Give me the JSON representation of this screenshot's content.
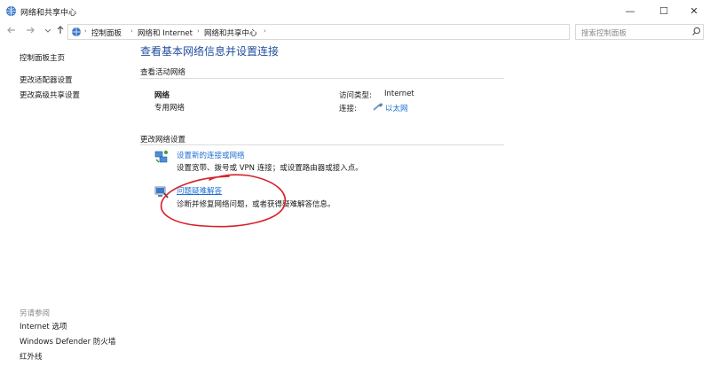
{
  "window": {
    "title": "网络和共享中心",
    "minimize_glyph": "—",
    "maximize_glyph": "☐",
    "close_glyph": "✕"
  },
  "address_bar": {
    "breadcrumbs": [
      "控制面板",
      "网络和 Internet",
      "网络和共享中心"
    ],
    "search_placeholder": "搜索控制面板"
  },
  "sidebar": {
    "links": [
      "控制面板主页",
      "更改适配器设置",
      "更改高级共享设置"
    ],
    "see_also_heading": "另请参阅",
    "see_also": [
      "Internet 选项",
      "Windows Defender 防火墙",
      "红外线"
    ]
  },
  "main": {
    "title": "查看基本网络信息并设置连接",
    "active_networks_label": "查看活动网络",
    "network": {
      "name": "网络",
      "type": "专用网络",
      "access_type_label": "访问类型:",
      "access_type_value": "Internet",
      "connections_label": "连接:",
      "connection_value": "以太网"
    },
    "change_settings_label": "更改网络设置",
    "tasks": [
      {
        "link": "设置新的连接或网络",
        "description": "设置宽带、拨号或 VPN 连接；或设置路由器或接入点。"
      },
      {
        "link": "问题疑难解答",
        "description": "诊断并修复网络问题，或者获得疑难解答信息。"
      }
    ]
  },
  "colors": {
    "title_blue": "#1f4e9c",
    "link_blue": "#1f6fd1",
    "annotation_red": "#d8202a"
  },
  "icons": {
    "window": "network-globe-icon",
    "back": "arrow-left-icon",
    "forward": "arrow-right-icon",
    "up": "arrow-up-icon",
    "refresh": "refresh-icon",
    "search": "search-icon",
    "ethernet": "ethernet-cable-icon",
    "new_connection": "network-setup-icon",
    "troubleshoot": "troubleshoot-icon"
  }
}
